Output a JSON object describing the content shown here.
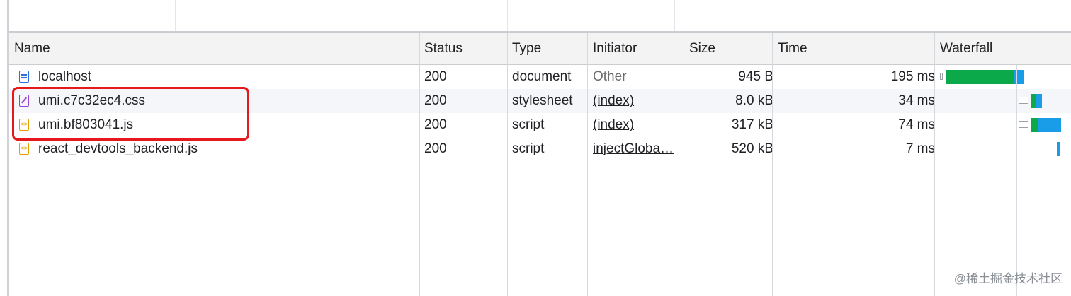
{
  "columns": {
    "name": "Name",
    "status": "Status",
    "type": "Type",
    "initiator": "Initiator",
    "size": "Size",
    "time": "Time",
    "waterfall": "Waterfall"
  },
  "requests": [
    {
      "name": "localhost",
      "status": "200",
      "type": "document",
      "initiator": "Other",
      "size": "945 B",
      "time": "195 ms",
      "icon": "document-icon"
    },
    {
      "name": "umi.c7c32ec4.css",
      "status": "200",
      "type": "stylesheet",
      "initiator": "(index)",
      "size": "8.0 kB",
      "time": "34 ms",
      "icon": "stylesheet-icon"
    },
    {
      "name": "umi.bf803041.js",
      "status": "200",
      "type": "script",
      "initiator": "(index)",
      "size": "317 kB",
      "time": "74 ms",
      "icon": "script-icon"
    },
    {
      "name": "react_devtools_backend.js",
      "status": "200",
      "type": "script",
      "initiator": "injectGloba…",
      "size": "520 kB",
      "time": "7 ms",
      "icon": "script-icon"
    }
  ],
  "colors": {
    "waiting": "#0ca94a",
    "download": "#1a9de9",
    "highlight": "#e5191c",
    "document_icon": "#2f6fdb",
    "stylesheet_icon": "#9b46d1",
    "script_icon": "#e5a000"
  },
  "watermark": "@稀土掘金技术社区"
}
